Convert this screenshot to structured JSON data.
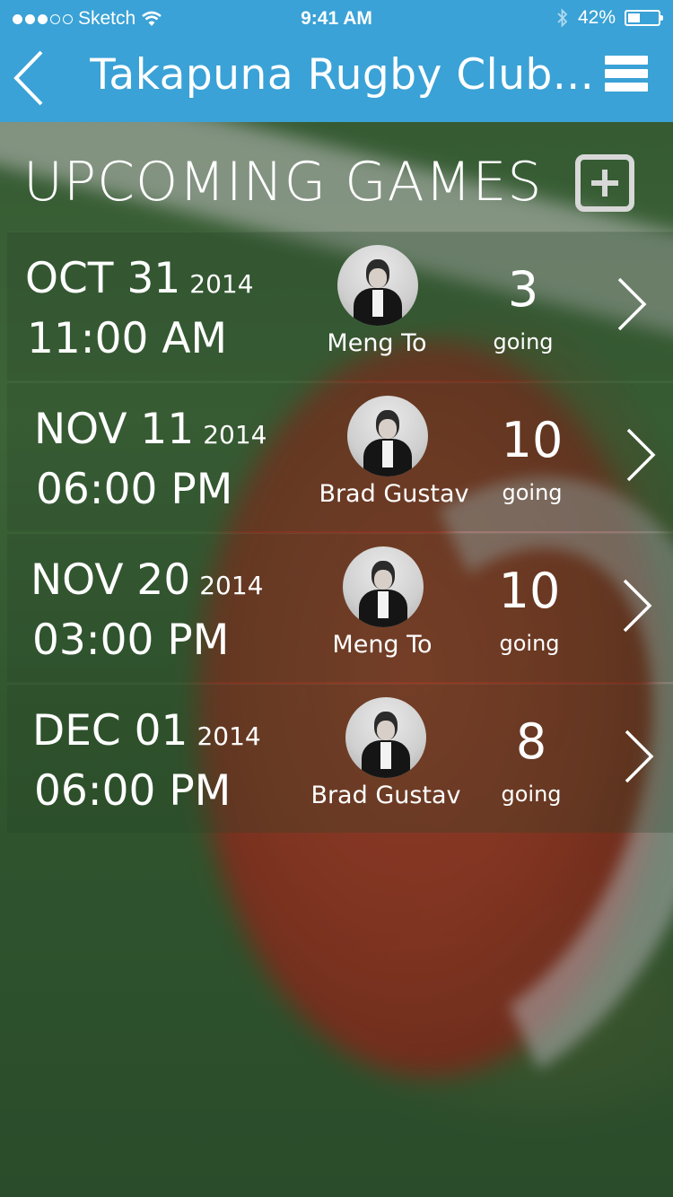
{
  "status_bar": {
    "carrier": "Sketch",
    "time": "9:41 AM",
    "battery": "42%",
    "battery_level": 0.42,
    "signal_dots_filled": 3,
    "signal_dots_total": 5,
    "icons": [
      "wifi-icon",
      "bluetooth-icon",
      "battery-icon"
    ]
  },
  "nav": {
    "title": "Takapuna Rugby Club...",
    "back_icon": "chevron-left-icon",
    "menu_icon": "hamburger-menu-icon",
    "bar_color": "#3aa2d6"
  },
  "section": {
    "title": "UPCOMING GAMES",
    "add_icon": "plus-square-icon"
  },
  "games": [
    {
      "date": "OCT 31",
      "year": "2014",
      "time": "11:00 AM",
      "organizer": "Meng To",
      "going_count": "3",
      "going_label": "going"
    },
    {
      "date": "NOV 11",
      "year": "2014",
      "time": "06:00 PM",
      "organizer": "Brad Gustav",
      "going_count": "10",
      "going_label": "going"
    },
    {
      "date": "NOV 20",
      "year": "2014",
      "time": "03:00 PM",
      "organizer": "Meng To",
      "going_count": "10",
      "going_label": "going"
    },
    {
      "date": "DEC 01",
      "year": "2014",
      "time": "06:00 PM",
      "organizer": "Brad Gustav",
      "going_count": "8",
      "going_label": "going"
    }
  ]
}
